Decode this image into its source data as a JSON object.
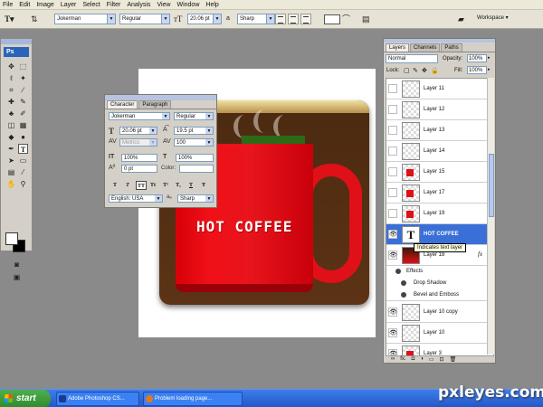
{
  "menu": [
    "File",
    "Edit",
    "Image",
    "Layer",
    "Select",
    "Filter",
    "Analysis",
    "View",
    "Window",
    "Help"
  ],
  "options": {
    "font_family": "Jokerman",
    "font_style": "Regular",
    "font_size": "20.06 pt",
    "antialias": "Sharp",
    "workspace": "Workspace ▾"
  },
  "tools": {
    "app_badge": "Ps"
  },
  "canvas": {
    "mug_text": "HOT COFFEE"
  },
  "character": {
    "tabs": [
      "Character",
      "Paragraph"
    ],
    "font_family": "Jokerman",
    "font_style": "Regular",
    "font_size": "20.06 pt",
    "leading": "19.5 pt",
    "kerning": "Metrics",
    "tracking": "100",
    "vertical_scale": "100%",
    "horizontal_scale": "100%",
    "baseline_shift": "0 pt",
    "color_label": "Color:",
    "language": "English: USA",
    "antialias": "Sharp",
    "style_buttons": [
      "T",
      "T",
      "TT",
      "Tt",
      "T¹",
      "T₁",
      "T",
      "Ŧ"
    ]
  },
  "layers_panel": {
    "tabs": [
      "Layers",
      "Channels",
      "Paths"
    ],
    "blend_mode": "Normal",
    "opacity_label": "Opacity:",
    "opacity": "100%",
    "lock_label": "Lock:",
    "fill_label": "Fill:",
    "fill": "100%",
    "tooltip": "Indicates text layer",
    "layers": [
      {
        "name": "Layer 11",
        "thumb": "checker"
      },
      {
        "name": "Layer 12",
        "thumb": "checker"
      },
      {
        "name": "Layer 13",
        "thumb": "checker"
      },
      {
        "name": "Layer 14",
        "thumb": "checker"
      },
      {
        "name": "Layer 15",
        "thumb": "red"
      },
      {
        "name": "Layer 17",
        "thumb": "red"
      },
      {
        "name": "Layer 19",
        "thumb": "red"
      },
      {
        "name": "HOT COFFEE",
        "thumb": "text",
        "selected": true
      },
      {
        "name": "Layer 18",
        "thumb": "dark",
        "fx": "fx"
      },
      {
        "name": "Layer 10 copy",
        "thumb": "checker"
      },
      {
        "name": "Layer 10",
        "thumb": "checker"
      },
      {
        "name": "Layer 3",
        "thumb": "red"
      }
    ],
    "effects_label": "Effects",
    "effects": [
      "Drop Shadow",
      "Bevel and Emboss"
    ],
    "footer": [
      "∞",
      "fx.",
      "◘",
      "◑",
      "▭",
      "⊡",
      "🗑"
    ]
  },
  "taskbar": {
    "start": "start",
    "tasks": [
      "Adobe Photoshop CS...",
      "Problem loading page..."
    ]
  },
  "watermark": "pxleyes.com"
}
